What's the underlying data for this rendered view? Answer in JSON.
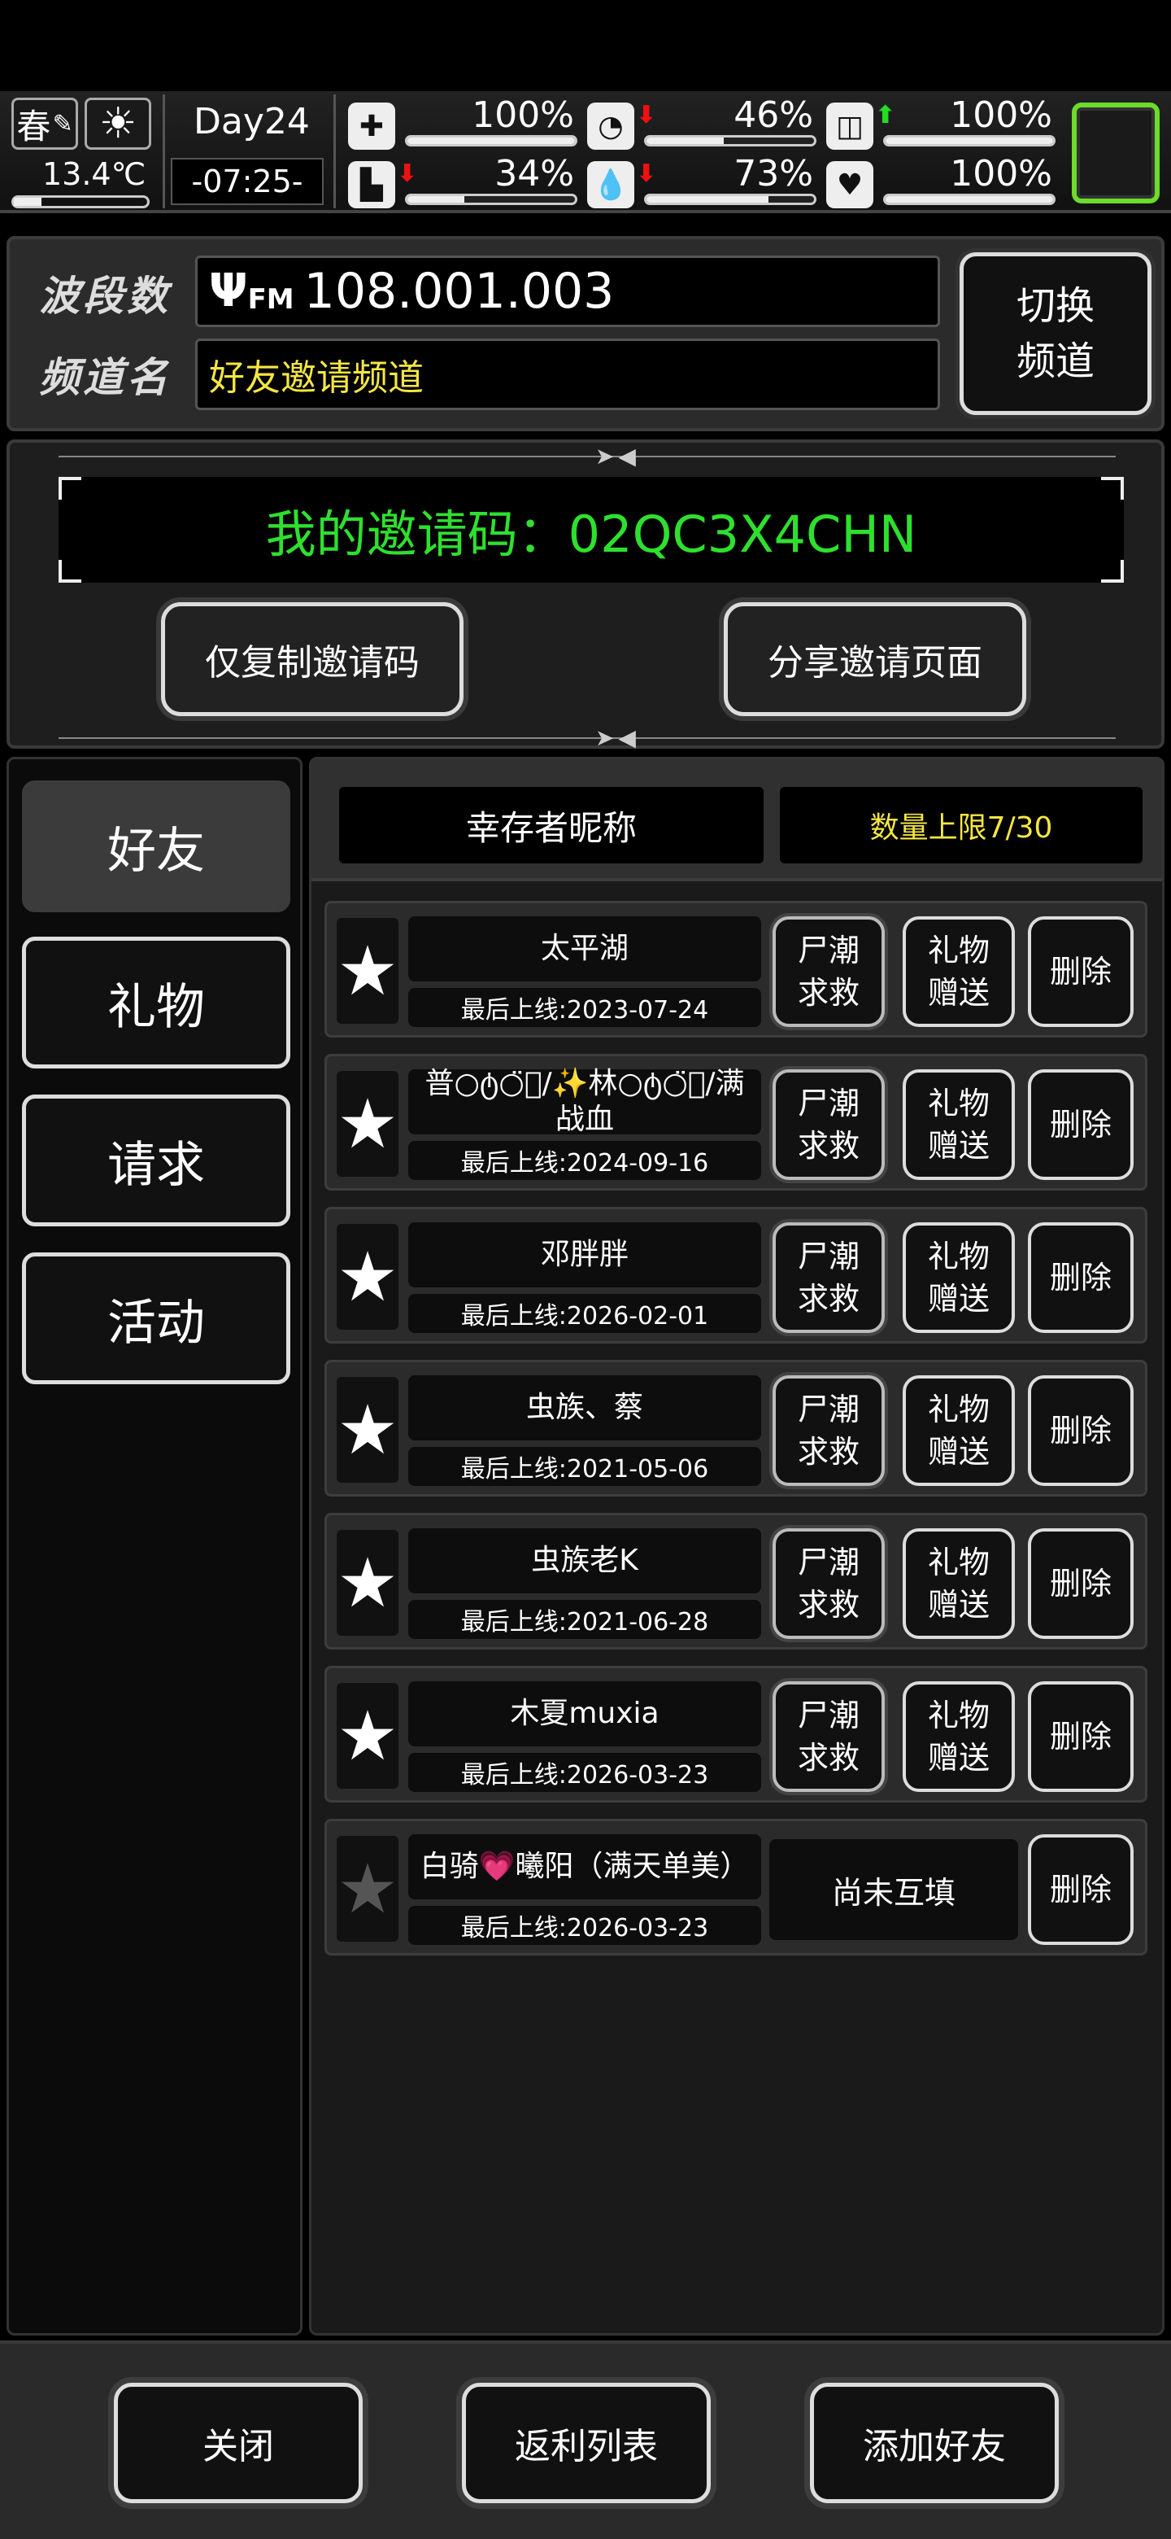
{
  "status": {
    "season": "春",
    "weather_icon": "sun-icon",
    "temperature": "13.4℃",
    "day": "Day24",
    "time": "-07:25-",
    "meters": [
      {
        "name": "health",
        "icon": "first-aid-icon",
        "value": "100%",
        "fraction": 1.0,
        "trend": ""
      },
      {
        "name": "hunger",
        "icon": "stomach-icon",
        "value": "46%",
        "fraction": 0.46,
        "trend": "down"
      },
      {
        "name": "medicine",
        "icon": "pill-icon",
        "value": "100%",
        "fraction": 1.0,
        "trend": "up"
      },
      {
        "name": "stamina",
        "icon": "boot-icon",
        "value": "34%",
        "fraction": 0.34,
        "trend": "down"
      },
      {
        "name": "thirst",
        "icon": "water-drop-icon",
        "value": "73%",
        "fraction": 0.73,
        "trend": "down"
      },
      {
        "name": "mood",
        "icon": "heart-icon",
        "value": "100%",
        "fraction": 1.0,
        "trend": ""
      }
    ]
  },
  "radio": {
    "band_label": "波段数",
    "channel_label": "频道名",
    "fm_tag": "FM",
    "frequency": "108.001.003",
    "channel_name": "好友邀请频道",
    "switch_label": "切换频道"
  },
  "invite": {
    "code_text": "我的邀请码：02QC3X4CHN",
    "copy_label": "仅复制邀请码",
    "share_label": "分享邀请页面"
  },
  "nav": [
    {
      "label": "好友",
      "active": true
    },
    {
      "label": "礼物",
      "active": false
    },
    {
      "label": "请求",
      "active": false
    },
    {
      "label": "活动",
      "active": false
    }
  ],
  "friends_header": {
    "name_col": "幸存者昵称",
    "limit": "数量上限7/30"
  },
  "friends": [
    {
      "name": "太平湖",
      "last_online": "最后上线:2023-07-24",
      "mutual": true
    },
    {
      "name": "普○ტ○̈⃝/✨林○ტ○̈⃝/满战血",
      "last_online": "最后上线:2024-09-16",
      "mutual": true
    },
    {
      "name": "邓胖胖",
      "last_online": "最后上线:2026-02-01",
      "mutual": true
    },
    {
      "name": "虫族、蔡",
      "last_online": "最后上线:2021-05-06",
      "mutual": true
    },
    {
      "name": "虫族老K",
      "last_online": "最后上线:2021-06-28",
      "mutual": true
    },
    {
      "name": "木夏muxia",
      "last_online": "最后上线:2026-03-23",
      "mutual": true
    },
    {
      "name": "白骑💗曦阳（满天单美）",
      "last_online": "最后上线:2026-03-23",
      "mutual": false
    }
  ],
  "row_actions": {
    "rescue": "尸潮求救",
    "gift": "礼物赠送",
    "delete": "删除",
    "pending": "尚未互填"
  },
  "bottom": {
    "close": "关闭",
    "rebate": "返利列表",
    "add_friend": "添加好友"
  },
  "colors": {
    "invite_code": "#2ee02e",
    "channel_name": "#f5e642",
    "limit_text": "#f5e642",
    "trend_up": "#22dd22",
    "trend_down": "#ee1111"
  }
}
